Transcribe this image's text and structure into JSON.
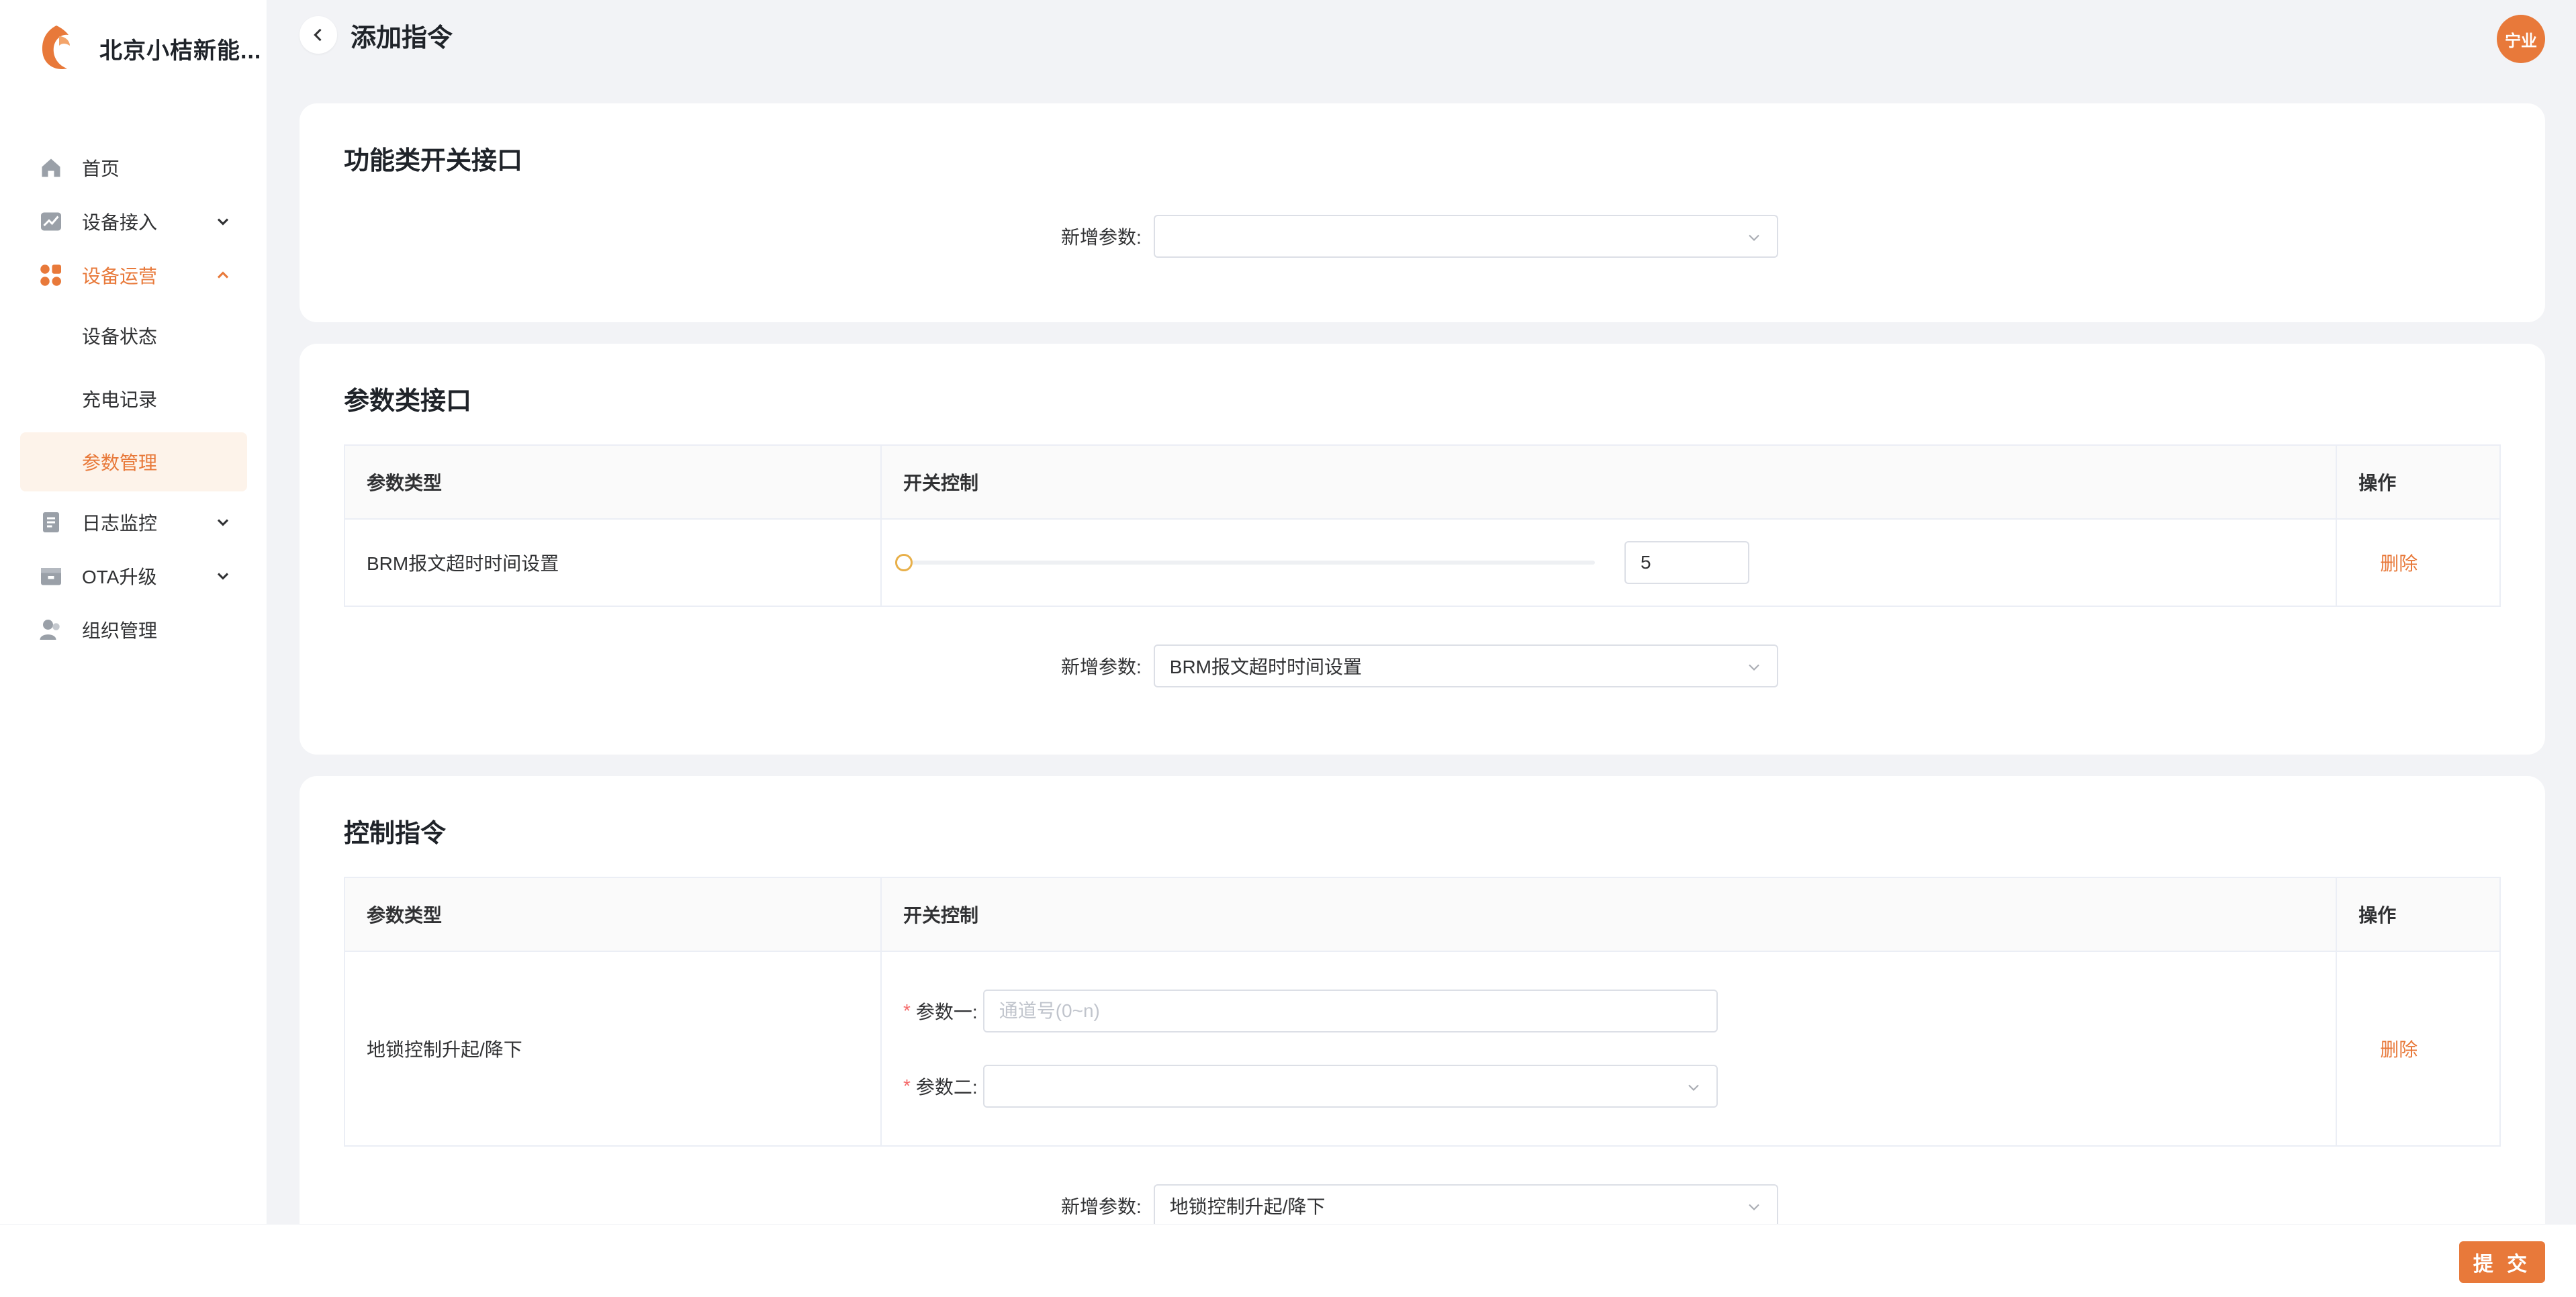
{
  "brand": {
    "name": "北京小桔新能..."
  },
  "sidebar": {
    "items": [
      {
        "label": "首页",
        "icon": "home-icon"
      },
      {
        "label": "设备接入",
        "icon": "chart-icon"
      },
      {
        "label": "设备运营",
        "icon": "apps-icon",
        "expanded": true,
        "children": [
          {
            "label": "设备状态"
          },
          {
            "label": "充电记录"
          },
          {
            "label": "参数管理",
            "active": true
          }
        ]
      },
      {
        "label": "日志监控",
        "icon": "document-icon"
      },
      {
        "label": "OTA升级",
        "icon": "archive-icon"
      },
      {
        "label": "组织管理",
        "icon": "users-icon"
      }
    ]
  },
  "header": {
    "title": "添加指令",
    "avatar_text": "宁业"
  },
  "section1": {
    "title": "功能类开关接口",
    "add_label": "新增参数:",
    "add_value": ""
  },
  "section2": {
    "title": "参数类接口",
    "columns": [
      "参数类型",
      "开关控制",
      "操作"
    ],
    "row": {
      "type": "BRM报文超时时间设置",
      "slider_value": 0,
      "input_value": "5",
      "action": "删除"
    },
    "add_label": "新增参数:",
    "add_value": "BRM报文超时时间设置"
  },
  "section3": {
    "title": "控制指令",
    "columns": [
      "参数类型",
      "开关控制",
      "操作"
    ],
    "row": {
      "type": "地锁控制升起/降下",
      "param1_label": "参数一:",
      "param1_placeholder": "通道号(0~n)",
      "param2_label": "参数二:",
      "param2_value": "",
      "action": "删除",
      "required_mark": "*"
    },
    "add_label": "新增参数:",
    "add_value": "地锁控制升起/降下"
  },
  "footer": {
    "submit_label": "提 交"
  },
  "colors": {
    "accent": "#e8793a",
    "background": "#f2f3f6",
    "required": "#f56c6c"
  }
}
